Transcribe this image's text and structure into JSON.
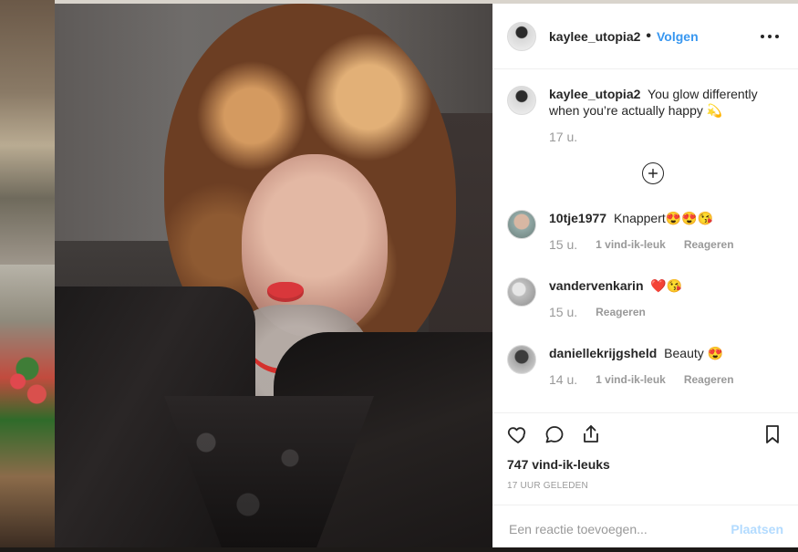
{
  "post": {
    "username": "kaylee_utopia2",
    "separator": "•",
    "follow_label": "Volgen",
    "caption": {
      "username": "kaylee_utopia2",
      "text": "You glow differently when you’re actually happy 💫",
      "time": "17 u."
    },
    "comments": [
      {
        "username": "10tje1977",
        "text": "Knappert😍😍😘",
        "time": "15 u.",
        "likes_label": "1 vind-ik-leuk",
        "reply_label": "Reageren"
      },
      {
        "username": "vandervenkarin",
        "text": "❤️😘",
        "time": "15 u.",
        "reply_label": "Reageren"
      },
      {
        "username": "daniellekrijgsheld",
        "text": "Beauty 😍",
        "time": "14 u.",
        "likes_label": "1 vind-ik-leuk",
        "reply_label": "Reageren"
      }
    ],
    "likes_count_label": "747 vind-ik-leuks",
    "posted_label": "17 UUR GELEDEN",
    "add_comment": {
      "placeholder": "Een reactie toevoegen...",
      "post_label": "Plaatsen"
    }
  },
  "icons": {
    "more": "more-options-icon",
    "plus": "load-more-comments-icon",
    "heart": "heart-icon",
    "comment": "comment-icon",
    "share": "share-icon",
    "save": "bookmark-icon"
  },
  "colors": {
    "link_blue": "#3897f0",
    "post_disabled": "#b3dbff",
    "text": "#262626",
    "muted": "#999999",
    "border": "#efefef"
  }
}
